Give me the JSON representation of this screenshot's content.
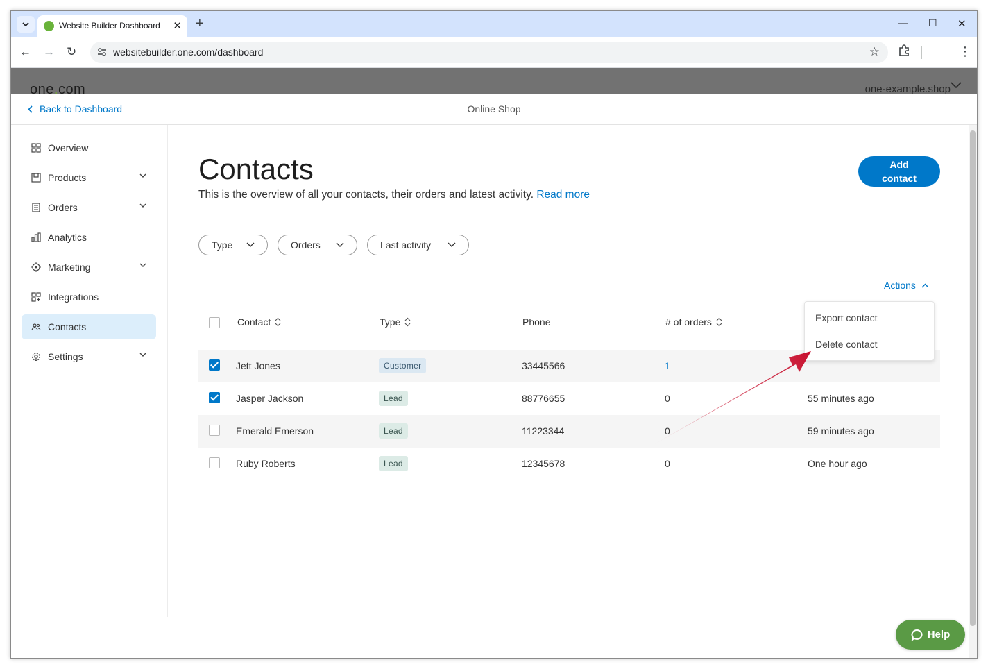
{
  "browser": {
    "tab_title": "Website Builder Dashboard",
    "url": "websitebuilder.one.com/dashboard"
  },
  "site": {
    "logo_prefix": "one",
    "logo_dot": ".",
    "logo_suffix": "com",
    "domain": "one-example.shop",
    "brand_color": "#76b729"
  },
  "subheader": {
    "back_label": "Back to Dashboard",
    "context_label": "Online Shop"
  },
  "sidebar": {
    "items": [
      {
        "label": "Overview",
        "icon": "grid-icon"
      },
      {
        "label": "Products",
        "icon": "box-icon"
      },
      {
        "label": "Orders",
        "icon": "list-icon"
      },
      {
        "label": "Analytics",
        "icon": "bar-chart-icon"
      },
      {
        "label": "Marketing",
        "icon": "target-icon"
      },
      {
        "label": "Integrations",
        "icon": "puzzle-icon"
      },
      {
        "label": "Contacts",
        "icon": "people-icon"
      },
      {
        "label": "Settings",
        "icon": "gear-icon"
      }
    ]
  },
  "main": {
    "title": "Contacts",
    "description": "This is the overview of all your contacts, their orders and latest activity.",
    "read_more": "Read more",
    "add_button_line1": "Add",
    "add_button_line2": "contact",
    "accent_color": "#0078c9",
    "filters": [
      "Type",
      "Orders",
      "Last activity"
    ],
    "actions_label": "Actions",
    "actions_menu": [
      "Export contact",
      "Delete contact"
    ],
    "columns": [
      "Contact",
      "Type",
      "Phone",
      "# of orders"
    ],
    "rows": [
      {
        "name": "Jett Jones",
        "type": "Customer",
        "phone": "33445566",
        "orders": "1",
        "activity": "",
        "checked": true
      },
      {
        "name": "Jasper Jackson",
        "type": "Lead",
        "phone": "88776655",
        "orders": "0",
        "activity": "55 minutes ago",
        "checked": true
      },
      {
        "name": "Emerald Emerson",
        "type": "Lead",
        "phone": "11223344",
        "orders": "0",
        "activity": "59 minutes ago",
        "checked": false
      },
      {
        "name": "Ruby Roberts",
        "type": "Lead",
        "phone": "12345678",
        "orders": "0",
        "activity": "One hour ago",
        "checked": false
      }
    ]
  },
  "help": {
    "label": "Help",
    "color": "#5a9a45"
  }
}
